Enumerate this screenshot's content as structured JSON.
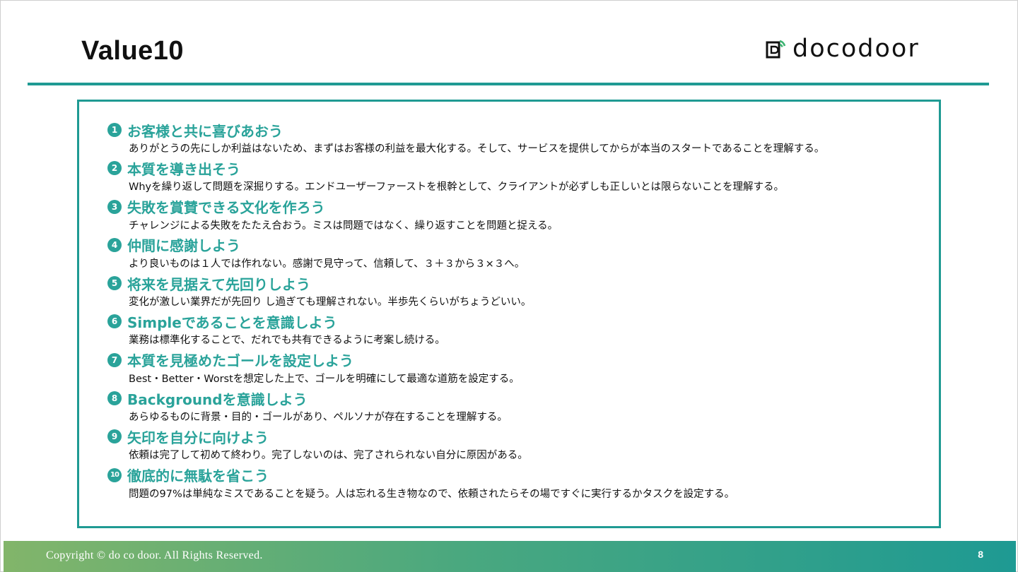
{
  "slide": {
    "title": "Value10",
    "logo_text": "docodoor",
    "footer_copyright": "Copyright © do co door.  All Rights Reserved.",
    "page_number": "8"
  },
  "values": [
    {
      "num": "1",
      "heading": "お客様と共に喜びあおう",
      "desc": "ありがとうの先にしか利益はないため、まずはお客様の利益を最大化する。そして、サービスを提供してからが本当のスタートであることを理解する。"
    },
    {
      "num": "2",
      "heading": "本質を導き出そう",
      "desc": "Whyを繰り返して問題を深掘りする。エンドユーザーファーストを根幹として、クライアントが必ずしも正しいとは限らないことを理解する。"
    },
    {
      "num": "3",
      "heading": "失敗を賞賛できる文化を作ろう",
      "desc": "チャレンジによる失敗をたたえ合おう。ミスは問題ではなく、繰り返すことを問題と捉える。"
    },
    {
      "num": "4",
      "heading": "仲間に感謝しよう",
      "desc": "より良いものは１人では作れない。感謝で見守って、信頼して、３＋３から３×３へ。"
    },
    {
      "num": "5",
      "heading": "将来を見据えて先回りしよう",
      "desc": "変化が激しい業界だが先回り し過ぎても理解されない。半歩先くらいがちょうどいい。"
    },
    {
      "num": "6",
      "heading": "Simpleであることを意識しよう",
      "desc": "業務は標準化することで、だれでも共有できるように考案し続ける。"
    },
    {
      "num": "7",
      "heading": "本質を見極めたゴールを設定しよう",
      "desc": "Best・Better・Worstを想定した上で、ゴールを明確にして最適な道筋を設定する。"
    },
    {
      "num": "8",
      "heading": "Backgroundを意識しよう",
      "desc": "あらゆるものに背景・目的・ゴールがあり、ペルソナが存在することを理解する。"
    },
    {
      "num": "9",
      "heading": "矢印を自分に向けよう",
      "desc": "依頼は完了して初めて終わり。完了しないのは、完了されられない自分に原因がある。"
    },
    {
      "num": "10",
      "heading": "徹底的に無駄を省こう",
      "desc": "問題の97%は単純なミスであることを疑う。人は忘れる生き物なので、依頼されたらその場ですぐに実行するかタスクを設定する。"
    }
  ],
  "colors": {
    "accent": "#2aa39a",
    "rule": "#1f9a93",
    "footer_start": "#82b56a",
    "footer_end": "#1e9a93"
  },
  "icons": {
    "logo": "door-signal-icon",
    "numbers": "circled-number-icon"
  }
}
